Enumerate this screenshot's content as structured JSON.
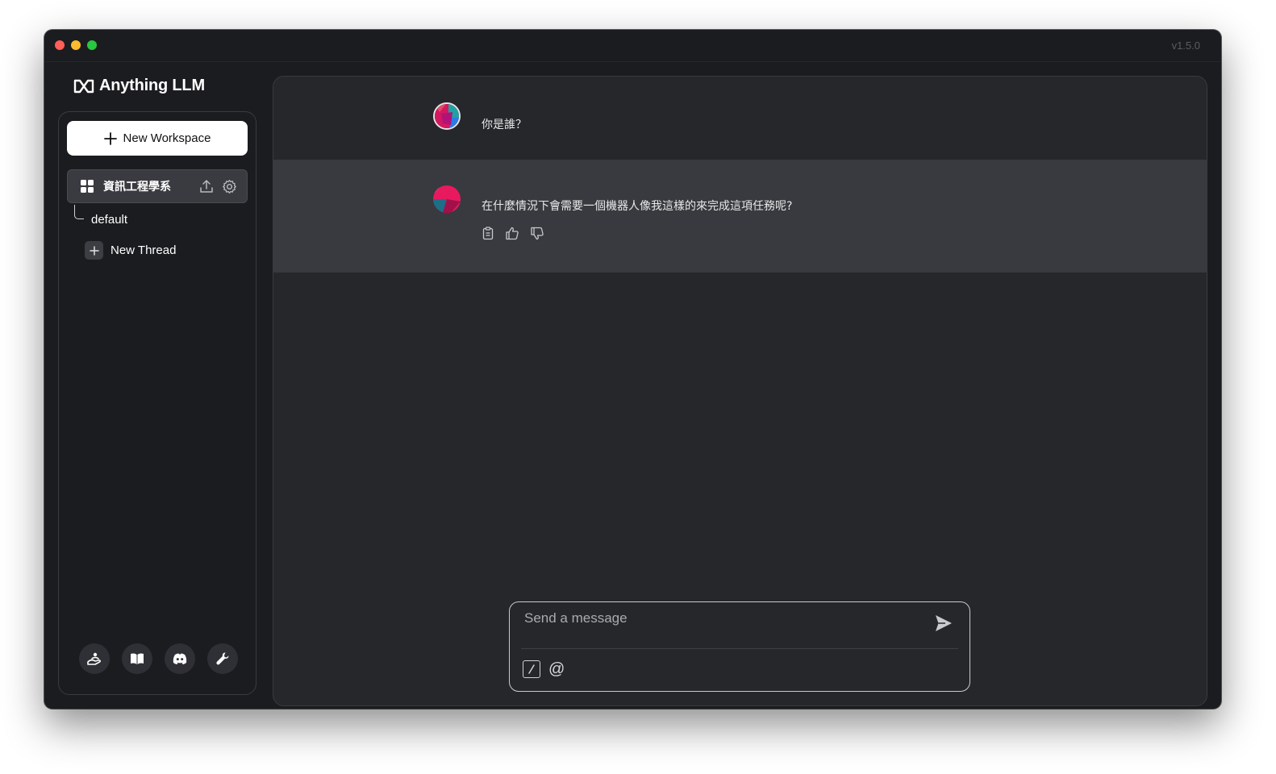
{
  "window": {
    "version": "v1.5.0"
  },
  "brand": {
    "name": "Anything LLM"
  },
  "sidebar": {
    "new_workspace_label": "New Workspace",
    "workspace": {
      "name": "資訊工程學系"
    },
    "threads": [
      {
        "label": "default"
      }
    ],
    "new_thread_label": "New Thread",
    "footer_icons": [
      "community-hub-icon",
      "docs-book-icon",
      "discord-icon",
      "settings-wrench-icon"
    ]
  },
  "chat": {
    "messages": [
      {
        "role": "user",
        "text": "你是誰？"
      },
      {
        "role": "assistant",
        "text": "在什麼情況下會需要一個機器人像我這樣的來完成這項任務呢?"
      }
    ]
  },
  "composer": {
    "placeholder": "Send a message",
    "slash_label": "/",
    "at_label": "@"
  },
  "colors": {
    "window_bg": "#1b1c1f",
    "main_bg": "#25272b",
    "assistant_row_bg": "#383a3f",
    "accent_white": "#ffffff"
  }
}
